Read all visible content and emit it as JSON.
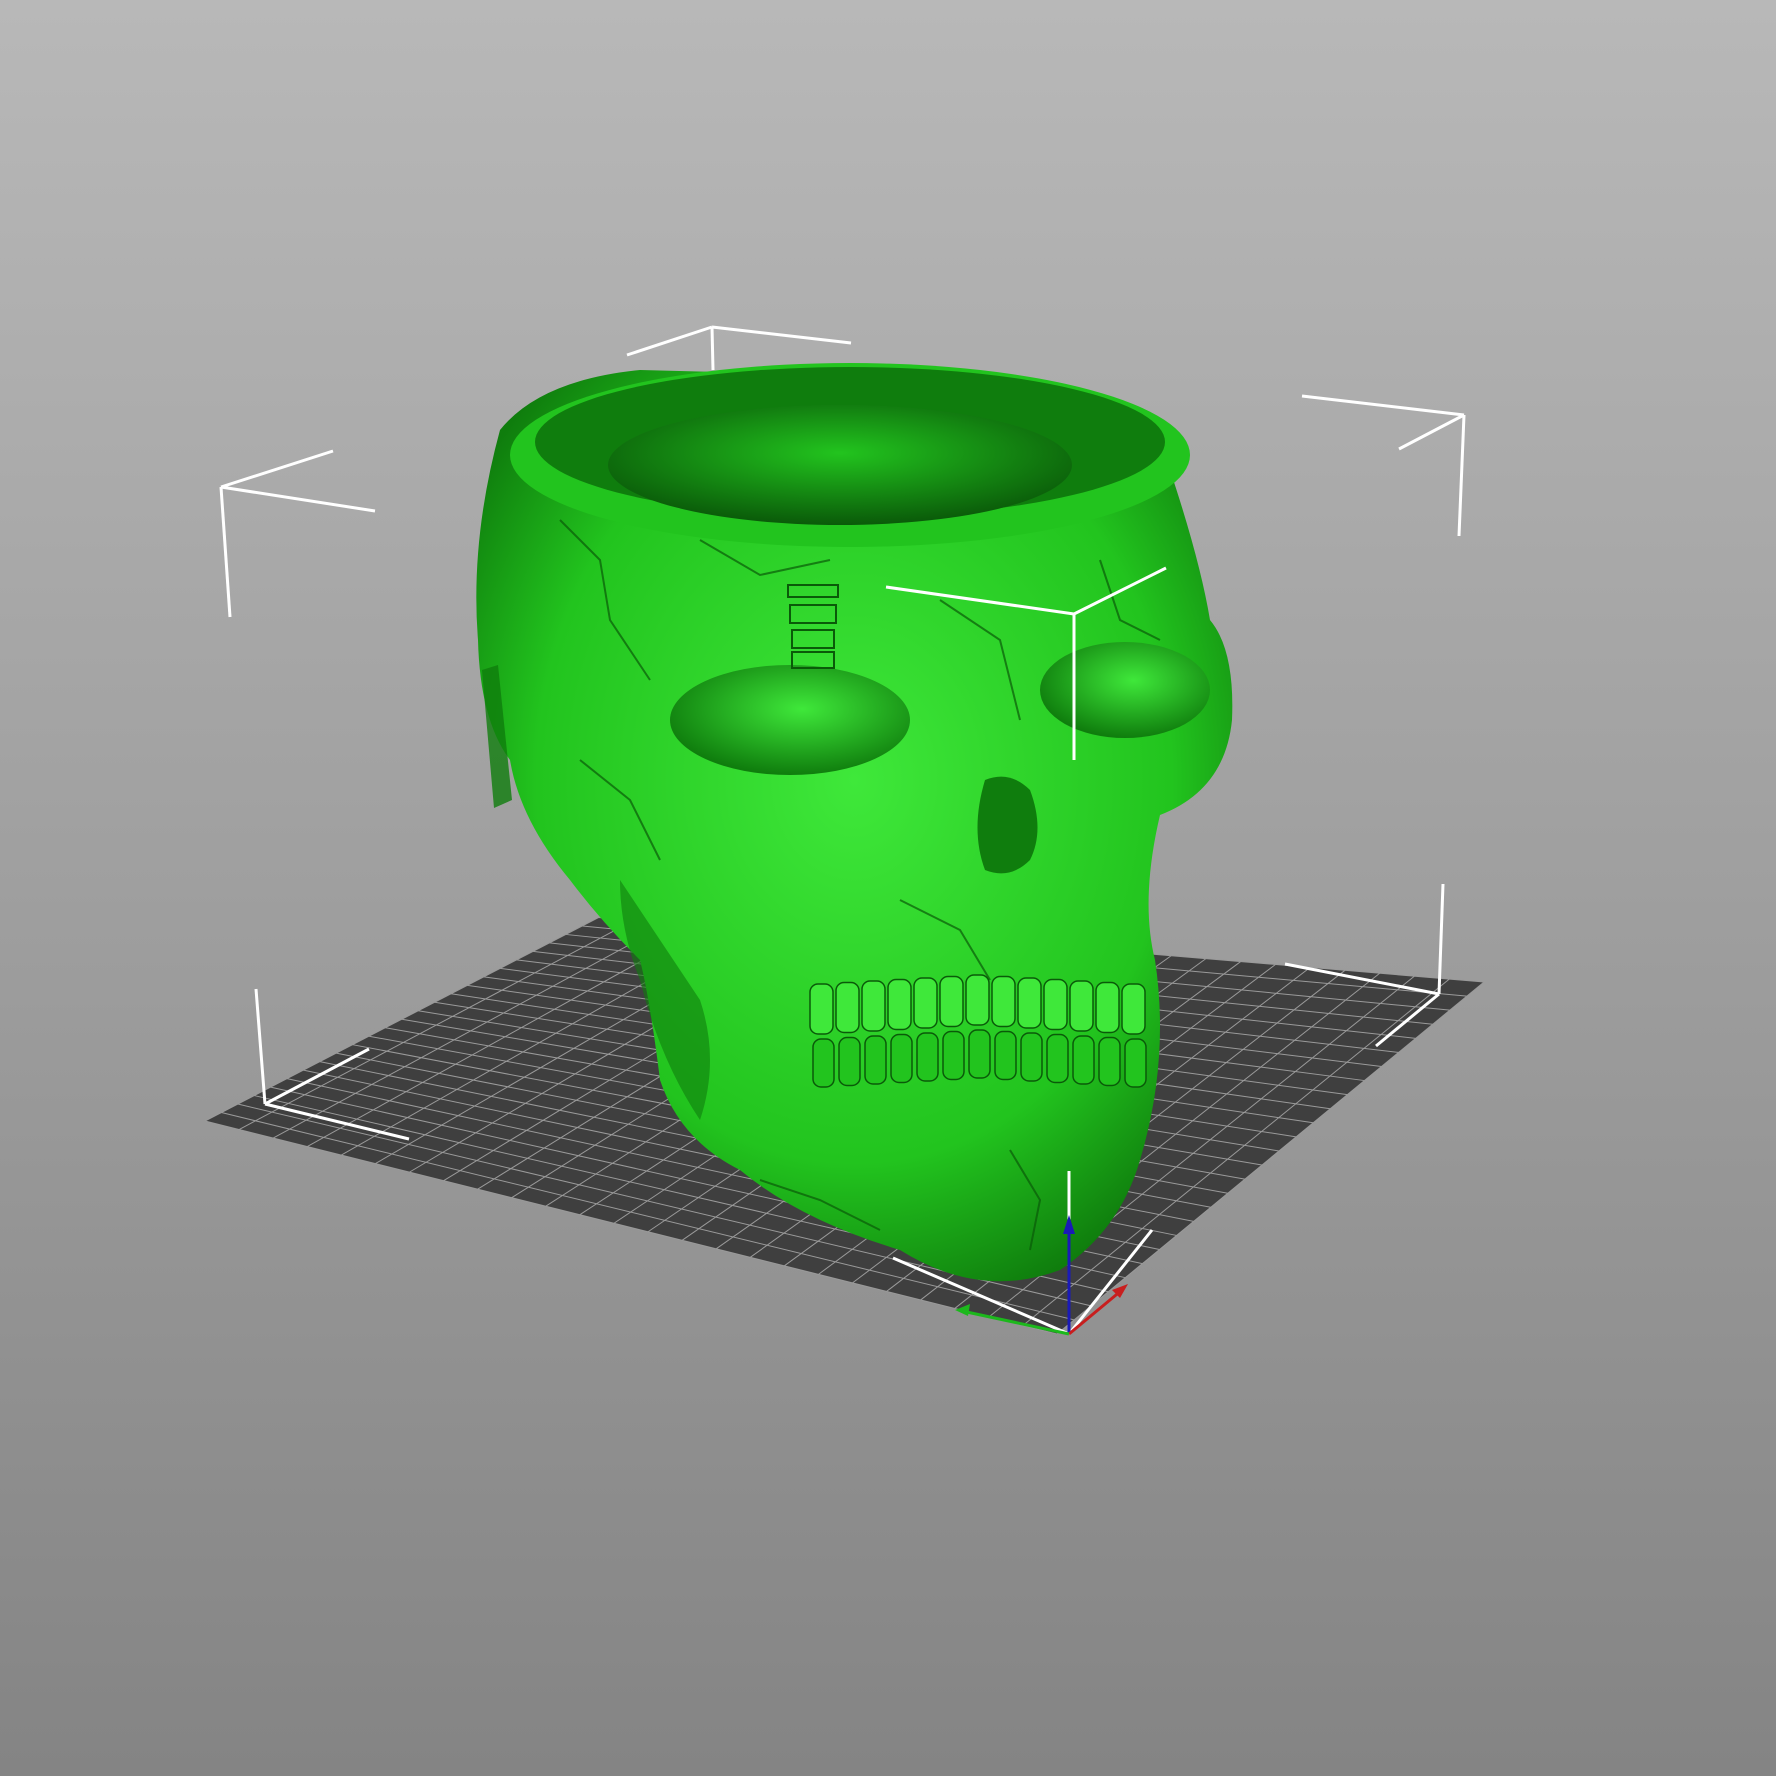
{
  "viewport": {
    "background_top": "#b8b8b8",
    "background_bottom": "#848484",
    "bed_color": "#3f3f3f",
    "bed_grid_color": "#9a9a9a",
    "bounding_box_color": "#ffffff"
  },
  "model": {
    "color": "#22c41e",
    "highlight_color": "#3fe83a",
    "shadow_color": "#0f7d0d",
    "dark_color": "#0a5a09"
  },
  "axes": {
    "x_color": "#c81e1e",
    "y_color": "#1cb81c",
    "z_color": "#1a1ab8"
  }
}
